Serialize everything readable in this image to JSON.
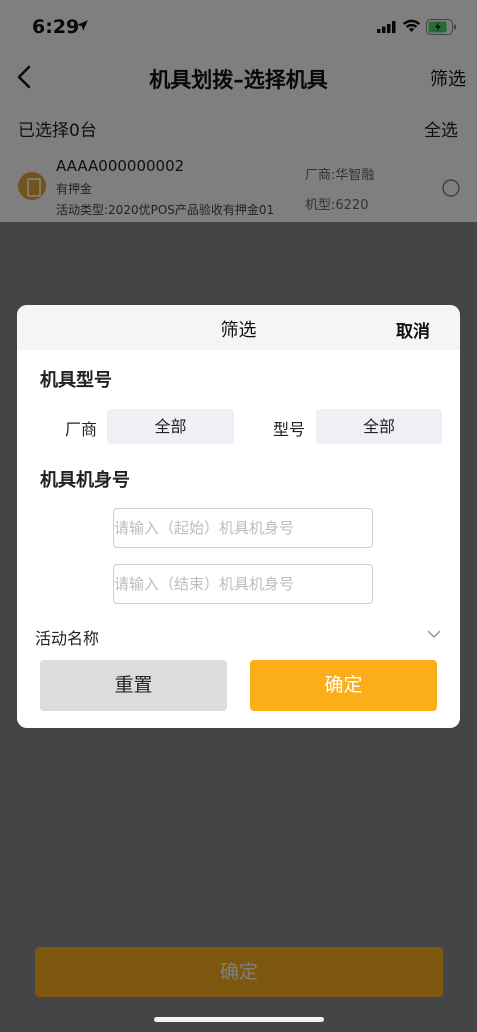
{
  "status_bar": {
    "time": "6:29"
  },
  "nav": {
    "title": "机具划拨–选择机具",
    "filter_label": "筛选"
  },
  "selection": {
    "count_text": "已选择0台",
    "select_all_label": "全选"
  },
  "device": {
    "serial": "AAAA000000002",
    "deposit_type": "有押金",
    "activity": "活动类型:2020优POS产品验收有押金01",
    "vendor": "厂商:华智融",
    "model": "机型:6220"
  },
  "bottom": {
    "confirm_label": "确定"
  },
  "filter_modal": {
    "title": "筛选",
    "cancel_label": "取消",
    "model_section_title": "机具型号",
    "vendor_label": "厂商",
    "vendor_value": "全部",
    "model_label": "型号",
    "model_value": "全部",
    "serial_section_title": "机具机身号",
    "serial_start_placeholder": "请输入（起始）机具机身号",
    "serial_end_placeholder": "请输入（结束）机具机身号",
    "activity_label": "活动名称",
    "reset_label": "重置",
    "confirm_label": "确定"
  },
  "colors": {
    "accent": "#fbae1a",
    "chip_bg": "#eff0f6"
  }
}
